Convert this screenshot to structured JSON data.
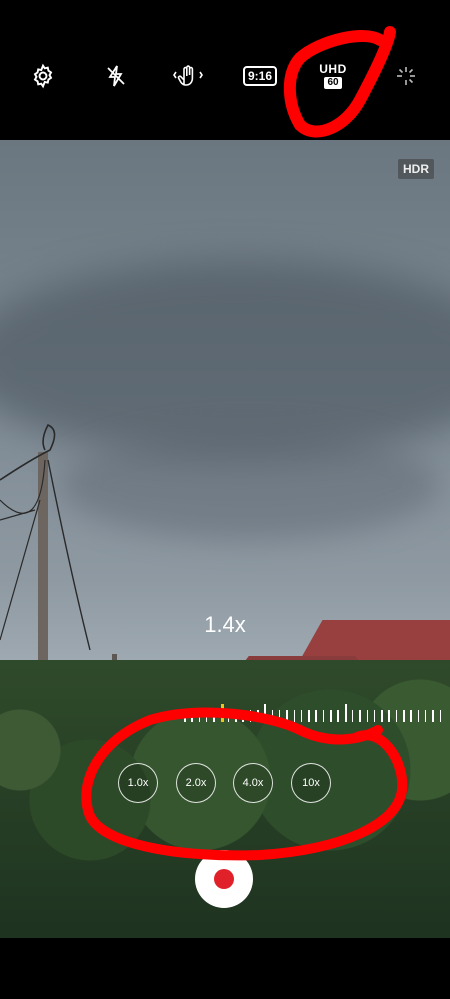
{
  "top_bar": {
    "settings_icon": "gear-icon",
    "flash_icon": "flash-off-icon",
    "stabilize_icon": "hand-stabilize-icon",
    "aspect_ratio": "9:16",
    "resolution_top": "UHD",
    "resolution_fps": "60",
    "effects_icon": "sparkle-icon"
  },
  "viewfinder": {
    "hdr_badge": "HDR",
    "zoom_level": "1.4x"
  },
  "zoom_buttons": [
    "1.0x",
    "2.0x",
    "4.0x",
    "10x"
  ],
  "record_button_color": "#e1212a",
  "annotation_color": "#ff0000"
}
